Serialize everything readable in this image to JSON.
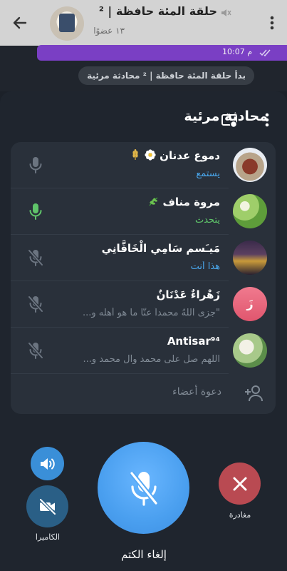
{
  "chat_header": {
    "title": "حلقة المئة حافظة | ²",
    "subtitle": "١٣ عضوًا",
    "icons": [
      "back-arrow-icon",
      "muted-icon",
      "more-vertical-icon"
    ]
  },
  "chat": {
    "message_time": "10:07 م",
    "service_message": "بدأ حلقة المئة حافظة | ² محادثة مرئية"
  },
  "sheet": {
    "title": "محادثة مرئية",
    "icons": [
      "screen-share-icon",
      "more-vertical-icon"
    ]
  },
  "participants": [
    {
      "name": "دموع عدنان",
      "emoji_icons": [
        "daisy-icon",
        "wheat-icon"
      ],
      "status": "يستمع",
      "status_color": "#4aa8ee",
      "mic": "muted-gray"
    },
    {
      "name": "مروة مناف",
      "emoji_icons": [
        "herb-icon"
      ],
      "status": "يتحدث",
      "status_color": "#5fc46a",
      "mic": "active-green"
    },
    {
      "name": "مَيـَسم سَامِي الْخَاقَّانِي",
      "emoji_icons": [],
      "status": "هذا أنت",
      "status_color": "#4aa8ee",
      "mic": "off"
    },
    {
      "name": "زَهْراءٌ عَدْنَانٌ",
      "emoji_icons": [],
      "status": "\"جزى اللّهُ محمداً عنّا ما هو أهله و...",
      "status_color": "#808a95",
      "mic": "off",
      "avatar_letter": "زَ"
    },
    {
      "name": "Antisar⁹⁴",
      "emoji_icons": [],
      "status": "اللهم صل على محمد وآل محمد و...",
      "status_color": "#808a95",
      "mic": "off"
    }
  ],
  "invite": {
    "label": "دعوة أعضاء",
    "icon": "add-user-icon"
  },
  "controls": {
    "speaker": {
      "icon": "speaker-icon"
    },
    "camera": {
      "label": "الكاميرا",
      "icon": "camera-off-icon"
    },
    "mic": {
      "label": "إلغاء الكتم",
      "icon": "mic-off-icon"
    },
    "leave": {
      "label": "مغادرة",
      "icon": "close-icon"
    }
  },
  "colors": {
    "accent_blue": "#4a9fef",
    "speaking_green": "#5fc46a",
    "leave_red": "#b94a52",
    "sheet_bg": "#1f252e",
    "list_bg": "#29303a"
  }
}
